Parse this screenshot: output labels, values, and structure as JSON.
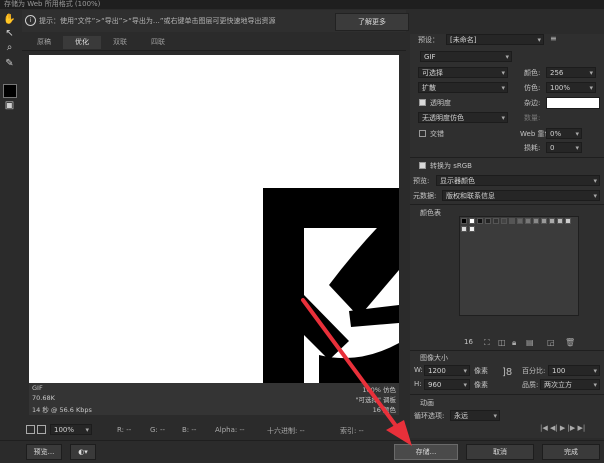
{
  "window": {
    "title": "存储为 Web 所用格式 (100%)"
  },
  "hint": {
    "text": "提示：使用“文件”>“导出”>“导出为…”或右键单击图层可更快速地导出资源",
    "learn_more": "了解更多"
  },
  "tabs": [
    {
      "label": "原稿",
      "active": false
    },
    {
      "label": "优化",
      "active": true
    },
    {
      "label": "双联",
      "active": false
    },
    {
      "label": "四联",
      "active": false
    }
  ],
  "info": {
    "format": "GIF",
    "size": "70.68K",
    "time": "14 秒 @ 56.6 Kbps",
    "right1": "100% 仿色",
    "right2": "\"可选择\" 调板",
    "right3": "16 颜色"
  },
  "status": {
    "zoom": "100%",
    "r": "R: --",
    "g": "G: --",
    "b": "B: --",
    "alpha": "Alpha: --",
    "hex": "十六进制: --",
    "index": "索引: --"
  },
  "bottom": {
    "preview": "预览...",
    "save": "存储...",
    "cancel": "取消",
    "done": "完成"
  },
  "panel": {
    "preset_label": "预设：",
    "preset_value": "[未命名]",
    "format_value": "GIF",
    "reduction_value": "可选择",
    "colors_label": "颜色:",
    "colors_value": "256",
    "dither_method": "扩散",
    "dither_label": "仿色:",
    "dither_value": "100%",
    "transparency_label": "透明度",
    "transparency_checked": true,
    "matte_label": "杂边:",
    "trans_dither": "无透明度仿色",
    "amount_label": "数量:",
    "interlaced_label": "交错",
    "interlaced_checked": false,
    "web_snap_label": "Web 靠色:",
    "web_snap_value": "0%",
    "lossy_label": "损耗:",
    "lossy_value": "0",
    "srgb_label": "转换为 sRGB",
    "srgb_checked": true,
    "preview_label": "预览:",
    "preview_value": "显示器颜色",
    "metadata_label": "元数据:",
    "metadata_value": "版权和联系信息",
    "color_table_label": "颜色表",
    "color_count": "16",
    "image_size_label": "图像大小",
    "w_label": "W:",
    "w_value": "1200",
    "h_label": "H:",
    "h_value": "960",
    "px": "像素",
    "percent_label": "百分比:",
    "percent_value": "100",
    "quality_label": "品质:",
    "quality_value": "两次立方",
    "animation_label": "动画",
    "loop_label": "循环选项:",
    "loop_value": "永远"
  },
  "colors": {
    "arrow": "#e8303a",
    "panel_bg": "#2f2f2f",
    "canvas_bg": "#ffffff"
  }
}
